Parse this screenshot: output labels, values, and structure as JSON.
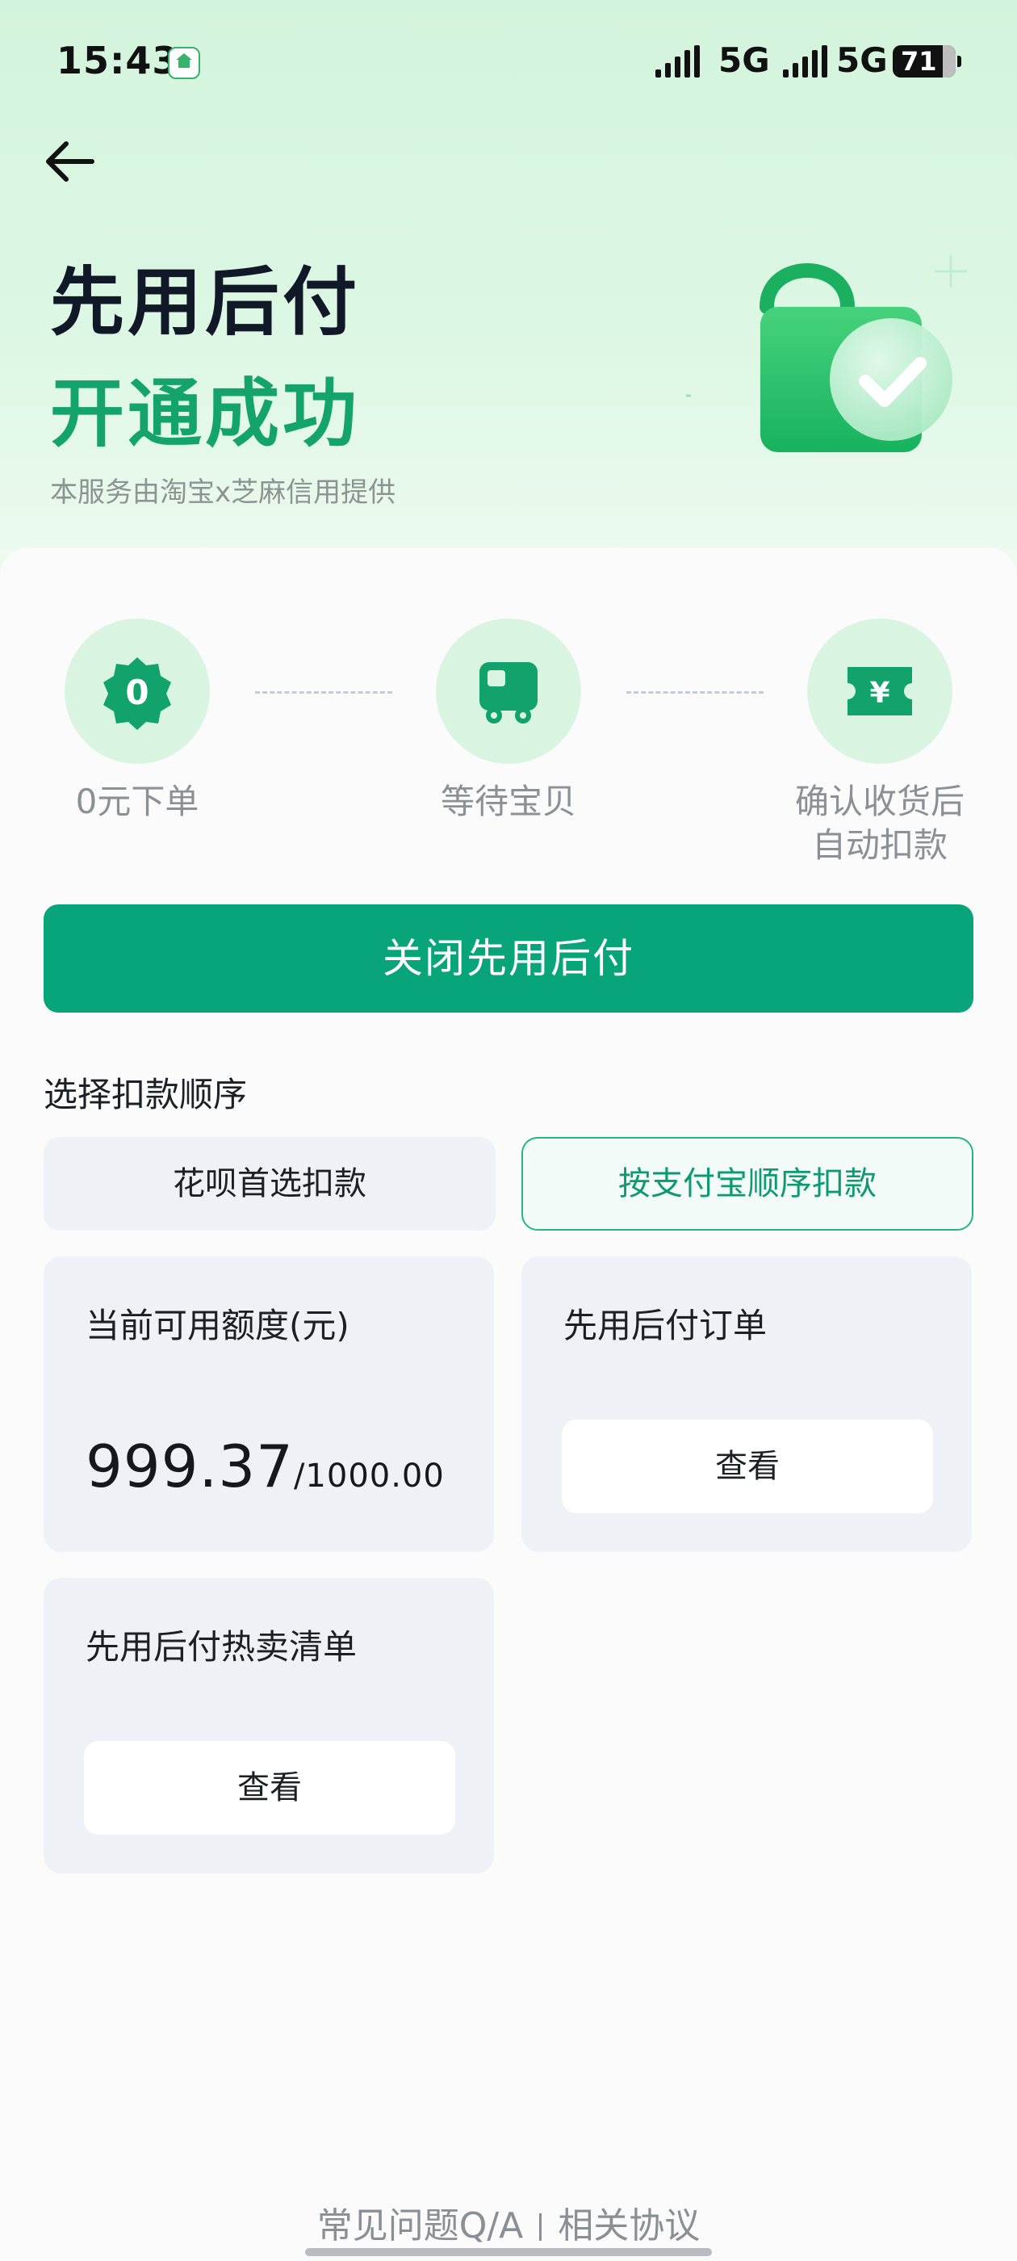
{
  "status_bar": {
    "time": "15:43",
    "network_1": "5G",
    "network_2": "5G",
    "battery": "71"
  },
  "header": {
    "title": "先用后付",
    "subtitle": "开通成功",
    "provider_note": "本服务由淘宝x芝麻信用提供"
  },
  "steps": [
    {
      "icon": "zero-badge-icon",
      "badge": "0",
      "label": "0元下单"
    },
    {
      "icon": "delivery-truck-icon",
      "label": "等待宝贝"
    },
    {
      "icon": "yuan-ticket-icon",
      "badge": "¥",
      "label": "确认收货后\n自动扣款"
    }
  ],
  "primary_action": {
    "label": "关闭先用后付"
  },
  "deduction_order": {
    "title": "选择扣款顺序",
    "options": [
      {
        "label": "花呗首选扣款",
        "selected": false
      },
      {
        "label": "按支付宝顺序扣款",
        "selected": true
      }
    ]
  },
  "tiles": {
    "quota": {
      "title": "当前可用额度(元)",
      "available": "999.37",
      "separator": "/",
      "total": "1000.00"
    },
    "orders": {
      "title": "先用后付订单",
      "button": "查看"
    },
    "hot_list": {
      "title": "先用后付热卖清单",
      "button": "查看"
    }
  },
  "footer": {
    "faq": "常见问题Q/A",
    "agreements": "相关协议"
  },
  "colors": {
    "accent": "#08a57a",
    "hero_green": "#14a36a",
    "step_circle": "#d9f5e2"
  }
}
